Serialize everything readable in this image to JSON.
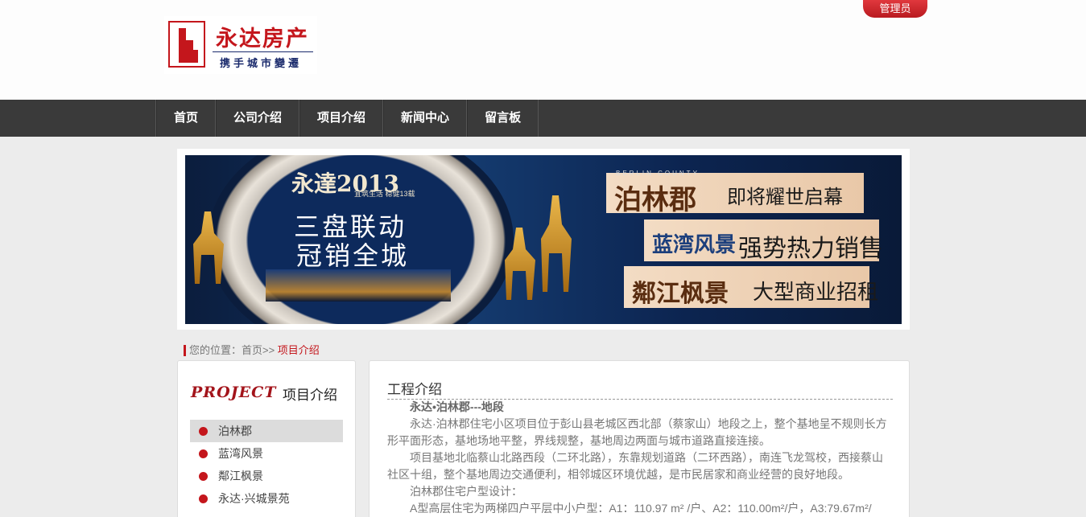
{
  "header": {
    "logo_name": "永达房产",
    "logo_slogan": "携手城市變遷",
    "admin_label": "管理员"
  },
  "nav": {
    "items": [
      "首页",
      "公司介绍",
      "项目介绍",
      "新闻中心",
      "留言板"
    ]
  },
  "banner": {
    "year_text": "永達2013",
    "year_sub": "宜筑生活 稳健13载",
    "slogan_line1": "三盘联动",
    "slogan_line2": "冠销全城",
    "panel_top": "BERLIN COUNTY",
    "panel1_name": "泊林郡",
    "panel1_text": "即将耀世启幕",
    "panel2_name": "蓝湾风景",
    "panel2_text": "强势热力销售",
    "panel3_name": "鄰江枫景",
    "panel3_text": "大型商业招租"
  },
  "breadcrumb": {
    "prefix": "您的位置：首页>> ",
    "current": "项目介绍"
  },
  "sidebar": {
    "title_en": "PROJECT",
    "title_cn": "项目介绍",
    "items": [
      {
        "label": "泊林郡",
        "active": true
      },
      {
        "label": "蓝湾风景",
        "active": false
      },
      {
        "label": "鄰江枫景",
        "active": false
      },
      {
        "label": "永达·兴城景苑",
        "active": false
      }
    ]
  },
  "content": {
    "title": "工程介绍",
    "heading": "永达•泊林郡---地段",
    "para1": "永达·泊林郡住宅小区项目位于彭山县老城区西北部（蔡家山）地段之上，整个基地呈不规则长方形平面形态，基地场地平整，界线规整，基地周边两面与城市道路直接连接。",
    "para2": "项目基地北临蔡山北路西段（二环北路），东靠规划道路（二环西路），南连飞龙驾校，西接蔡山社区十组，整个基地周边交通便利，相邻城区环境优越，是市民居家和商业经营的良好地段。",
    "para3": "泊林郡住宅户型设计：",
    "para4": "A型高层住宅为两梯四户平层中小户型：A1：110.97 m² /户、A2：110.00m²/户，A3:79.67m²/"
  }
}
